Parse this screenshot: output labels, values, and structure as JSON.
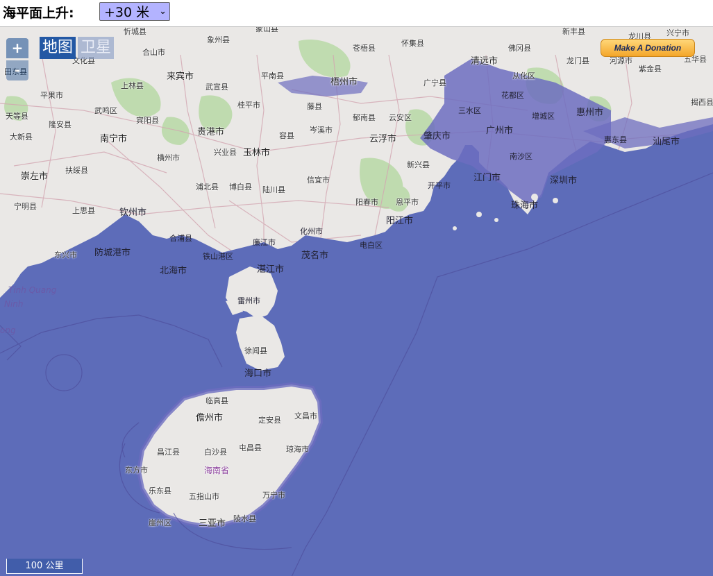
{
  "control": {
    "label": "海平面上升:",
    "selected": "+30 米"
  },
  "map": {
    "zoom_in": "+",
    "zoom_out": "-",
    "layer_map": "地图",
    "layer_satellite": "卫星",
    "donate": "Make A Donation",
    "scale": "100 公里",
    "colors": {
      "flood": "#5b6bb8",
      "land": "#f1efe8",
      "green": "#bfe0a8",
      "road": "#d6a0a8"
    },
    "labels": {
      "l0": "忻城县",
      "l1": "象州县",
      "l2": "蒙山县",
      "l3": "苍梧县",
      "l4": "怀集县",
      "l5": "清远市",
      "l6": "佛冈县",
      "l7": "从化区",
      "l8": "龙门县",
      "l9": "新丰县",
      "l10": "龙川县",
      "l11": "兴宁市",
      "l12": "五华县",
      "l13": "紫金县",
      "l14": "河源市",
      "l15": "合山市",
      "l16": "来宾市",
      "l17": "武宣县",
      "l18": "平南县",
      "l19": "梧州市",
      "l20": "广宁县",
      "l21": "上林县",
      "l22": "桂平市",
      "l23": "藤县",
      "l24": "郁南县",
      "l25": "云安区",
      "l26": "三水区",
      "l27": "花都区",
      "l28": "增城区",
      "l29": "惠州市",
      "l30": "揭西县",
      "l31": "平果市",
      "l32": "武鸣区",
      "l33": "宾阳县",
      "l34": "天等县",
      "l35": "隆安县",
      "l36": "贵港市",
      "l37": "容县",
      "l38": "岑溪市",
      "l39": "肇庆市",
      "l40": "广州市",
      "l41": "惠东县",
      "l42": "汕尾市",
      "l43": "大新县",
      "l44": "南宁市",
      "l45": "横州市",
      "l46": "兴业县",
      "l47": "玉林市",
      "l48": "云浮市",
      "l49": "新兴县",
      "l50": "南沙区",
      "l51": "崇左市",
      "l52": "扶绥县",
      "l53": "浦北县",
      "l54": "博白县",
      "l55": "陆川县",
      "l56": "信宜市",
      "l57": "开平市",
      "l58": "江门市",
      "l59": "深圳市",
      "l60": "宁明县",
      "l61": "上思县",
      "l62": "钦州市",
      "l63": "阳春市",
      "l64": "恩平市",
      "l65": "珠海市",
      "l66": "阳江市",
      "l67": "合浦县",
      "l68": "廉江市",
      "l69": "化州市",
      "l70": "电白区",
      "l71": "东兴市",
      "l72": "防城港市",
      "l73": "铁山港区",
      "l74": "茂名市",
      "l75": "北海市",
      "l76": "湛江市",
      "l77": "雷州市",
      "l78": "徐闻县",
      "l79": "海口市",
      "l80": "临高县",
      "l81": "儋州市",
      "l82": "定安县",
      "l83": "文昌市",
      "l84": "昌江县",
      "l85": "白沙县",
      "l86": "屯昌县",
      "l87": "琼海市",
      "l88": "东方市",
      "l89": "海南省",
      "l90": "乐东县",
      "l91": "五指山市",
      "l92": "万宁市",
      "l93": "崖州区",
      "l94": "三亚市",
      "l95": "陵水县",
      "l96": "Tinh Quang",
      "l97": "Ninh",
      "l98": "ong",
      "l99": "文化县",
      "l100": "田东县"
    }
  }
}
